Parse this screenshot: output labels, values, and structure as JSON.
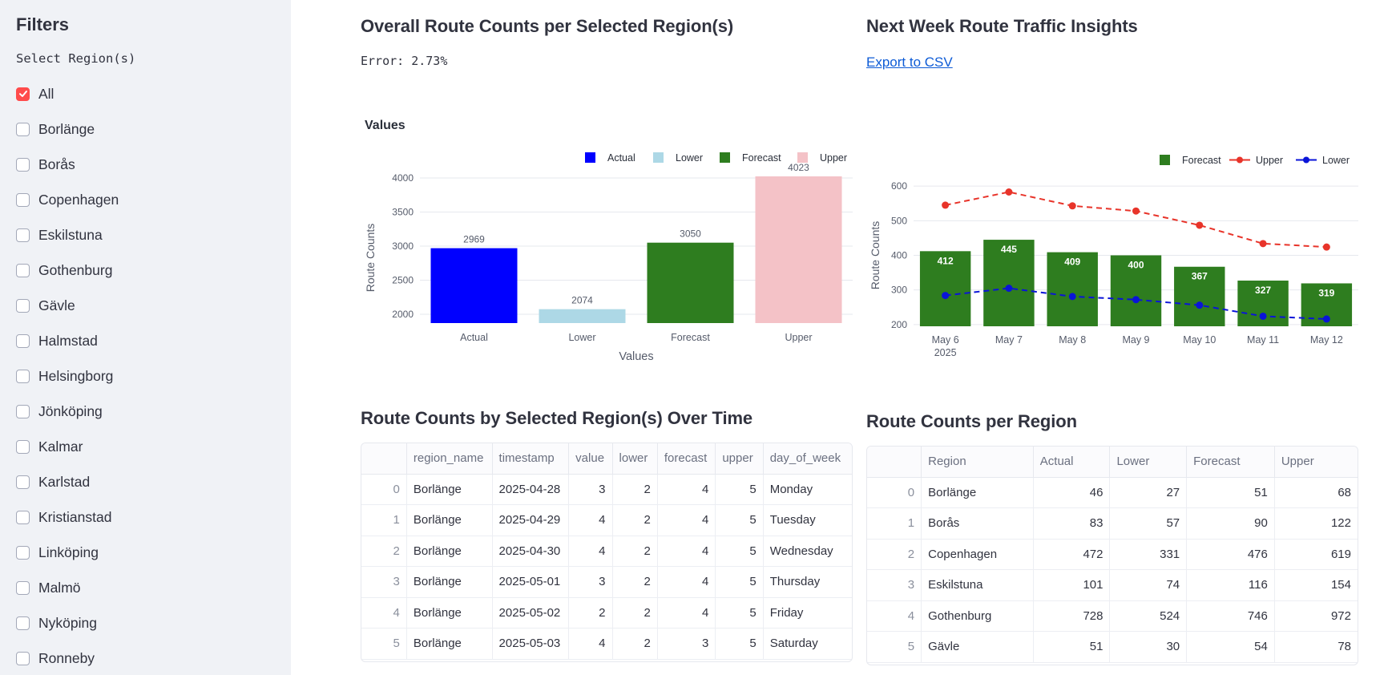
{
  "sidebar": {
    "title": "Filters",
    "select_label": "Select Region(s)",
    "regions": [
      {
        "label": "All",
        "checked": true
      },
      {
        "label": "Borlänge",
        "checked": false
      },
      {
        "label": "Borås",
        "checked": false
      },
      {
        "label": "Copenhagen",
        "checked": false
      },
      {
        "label": "Eskilstuna",
        "checked": false
      },
      {
        "label": "Gothenburg",
        "checked": false
      },
      {
        "label": "Gävle",
        "checked": false
      },
      {
        "label": "Halmstad",
        "checked": false
      },
      {
        "label": "Helsingborg",
        "checked": false
      },
      {
        "label": "Jönköping",
        "checked": false
      },
      {
        "label": "Kalmar",
        "checked": false
      },
      {
        "label": "Karlstad",
        "checked": false
      },
      {
        "label": "Kristianstad",
        "checked": false
      },
      {
        "label": "Linköping",
        "checked": false
      },
      {
        "label": "Malmö",
        "checked": false
      },
      {
        "label": "Nyköping",
        "checked": false
      },
      {
        "label": "Ronneby",
        "checked": false
      }
    ]
  },
  "overall": {
    "title": "Overall Route Counts per Selected Region(s)",
    "error_text": "Error: 2.73%"
  },
  "insights": {
    "title": "Next Week Route Traffic Insights",
    "export_label": "Export to CSV"
  },
  "colors": {
    "actual": "#0000ff",
    "lower": "#add8e6",
    "forecast": "#2e7d1f",
    "upper": "#f4c2c7",
    "upper_line": "#e8342a",
    "lower_line": "#0a14d8",
    "checkbox_accent": "#ff4b4b",
    "link": "#0d5bd6"
  },
  "chart_data": [
    {
      "type": "bar",
      "title": "Values",
      "xlabel": "Values",
      "ylabel": "Route Counts",
      "categories": [
        "Actual",
        "Lower",
        "Forecast",
        "Upper"
      ],
      "values": [
        2969,
        2074,
        3050,
        4023
      ],
      "data_labels": [
        "2969",
        "2074",
        "3050",
        "4023"
      ],
      "legend": [
        "Actual",
        "Lower",
        "Forecast",
        "Upper"
      ],
      "legend_position": "top-right",
      "yticks": [
        "2000",
        "2500",
        "3000",
        "3500",
        "4000"
      ],
      "ylim": [
        1870,
        4023
      ],
      "grid": true
    },
    {
      "type": "bar",
      "title": "",
      "xlabel": "",
      "ylabel": "Route Counts",
      "categories": [
        "May 6",
        "May 7",
        "May 8",
        "May 9",
        "May 10",
        "May 11",
        "May 12"
      ],
      "year_label": "2025",
      "series": [
        {
          "name": "Forecast",
          "kind": "bar",
          "values": [
            412,
            445,
            409,
            400,
            367,
            327,
            319
          ]
        },
        {
          "name": "Upper",
          "kind": "line",
          "values": [
            545,
            583,
            543,
            528,
            487,
            434,
            424
          ]
        },
        {
          "name": "Lower",
          "kind": "line",
          "values": [
            284,
            305,
            281,
            272,
            256,
            224,
            216
          ]
        }
      ],
      "data_labels": [
        "412",
        "445",
        "409",
        "400",
        "367",
        "327",
        "319"
      ],
      "legend": [
        "Forecast",
        "Upper",
        "Lower"
      ],
      "legend_position": "top-right",
      "yticks": [
        "200",
        "300",
        "400",
        "500",
        "600"
      ],
      "ylim": [
        195,
        605
      ],
      "grid": true
    }
  ],
  "timeseries_table": {
    "title": "Route Counts by Selected Region(s) Over Time",
    "columns": [
      "",
      "region_name",
      "timestamp",
      "value",
      "lower",
      "forecast",
      "upper",
      "day_of_week"
    ],
    "rows": [
      [
        "0",
        "Borlänge",
        "2025-04-28",
        "3",
        "2",
        "4",
        "5",
        "Monday"
      ],
      [
        "1",
        "Borlänge",
        "2025-04-29",
        "4",
        "2",
        "4",
        "5",
        "Tuesday"
      ],
      [
        "2",
        "Borlänge",
        "2025-04-30",
        "4",
        "2",
        "4",
        "5",
        "Wednesday"
      ],
      [
        "3",
        "Borlänge",
        "2025-05-01",
        "3",
        "2",
        "4",
        "5",
        "Thursday"
      ],
      [
        "4",
        "Borlänge",
        "2025-05-02",
        "2",
        "2",
        "4",
        "5",
        "Friday"
      ],
      [
        "5",
        "Borlänge",
        "2025-05-03",
        "4",
        "2",
        "3",
        "5",
        "Saturday"
      ]
    ]
  },
  "region_table": {
    "title": "Route Counts per Region",
    "columns": [
      "",
      "Region",
      "Actual",
      "Lower",
      "Forecast",
      "Upper"
    ],
    "rows": [
      [
        "0",
        "Borlänge",
        "46",
        "27",
        "51",
        "68"
      ],
      [
        "1",
        "Borås",
        "83",
        "57",
        "90",
        "122"
      ],
      [
        "2",
        "Copenhagen",
        "472",
        "331",
        "476",
        "619"
      ],
      [
        "3",
        "Eskilstuna",
        "101",
        "74",
        "116",
        "154"
      ],
      [
        "4",
        "Gothenburg",
        "728",
        "524",
        "746",
        "972"
      ],
      [
        "5",
        "Gävle",
        "51",
        "30",
        "54",
        "78"
      ]
    ]
  }
}
